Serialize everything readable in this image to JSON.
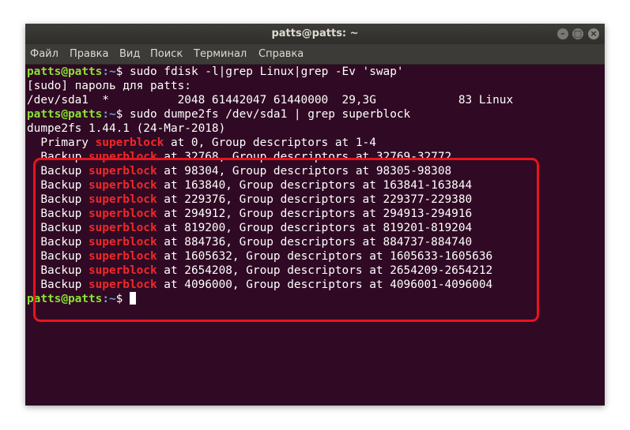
{
  "window": {
    "title": "patts@patts: ~"
  },
  "window_controls": {
    "minimize": "–",
    "maximize": "□",
    "close": "×"
  },
  "menu": [
    "Файл",
    "Правка",
    "Вид",
    "Поиск",
    "Терминал",
    "Справка"
  ],
  "prompt": {
    "user": "patts@patts",
    "path": ":~",
    "symbol": "$"
  },
  "terminal": {
    "cmd1": " sudo fdisk -l|grep Linux|grep -Ev 'swap'",
    "sudo_prompt": "[sudo] пароль для patts:",
    "fdisk_row": "/dev/sda1  *          2048 61442047 61440000  29,3G            83 Linux",
    "cmd2": " sudo dumpe2fs /dev/sda1 | grep superblock",
    "version": "dumpe2fs 1.44.1 (24-Mar-2018)",
    "superblocks": [
      {
        "pre": "  Primary ",
        "match": "superblock",
        "post": " at 0, Group descriptors at 1-4"
      },
      {
        "pre": "  Backup ",
        "match": "superblock",
        "post": " at 32768, Group descriptors at 32769-32772"
      },
      {
        "pre": "  Backup ",
        "match": "superblock",
        "post": " at 98304, Group descriptors at 98305-98308"
      },
      {
        "pre": "  Backup ",
        "match": "superblock",
        "post": " at 163840, Group descriptors at 163841-163844"
      },
      {
        "pre": "  Backup ",
        "match": "superblock",
        "post": " at 229376, Group descriptors at 229377-229380"
      },
      {
        "pre": "  Backup ",
        "match": "superblock",
        "post": " at 294912, Group descriptors at 294913-294916"
      },
      {
        "pre": "  Backup ",
        "match": "superblock",
        "post": " at 819200, Group descriptors at 819201-819204"
      },
      {
        "pre": "  Backup ",
        "match": "superblock",
        "post": " at 884736, Group descriptors at 884737-884740"
      },
      {
        "pre": "  Backup ",
        "match": "superblock",
        "post": " at 1605632, Group descriptors at 1605633-1605636"
      },
      {
        "pre": "  Backup ",
        "match": "superblock",
        "post": " at 2654208, Group descriptors at 2654209-2654212"
      },
      {
        "pre": "  Backup ",
        "match": "superblock",
        "post": " at 4096000, Group descriptors at 4096001-4096004"
      }
    ]
  },
  "colors": {
    "background": "#300a24",
    "prompt_user": "#8ae234",
    "prompt_path": "#729fcf",
    "match": "#ef2929",
    "highlight": "#e8141e"
  }
}
